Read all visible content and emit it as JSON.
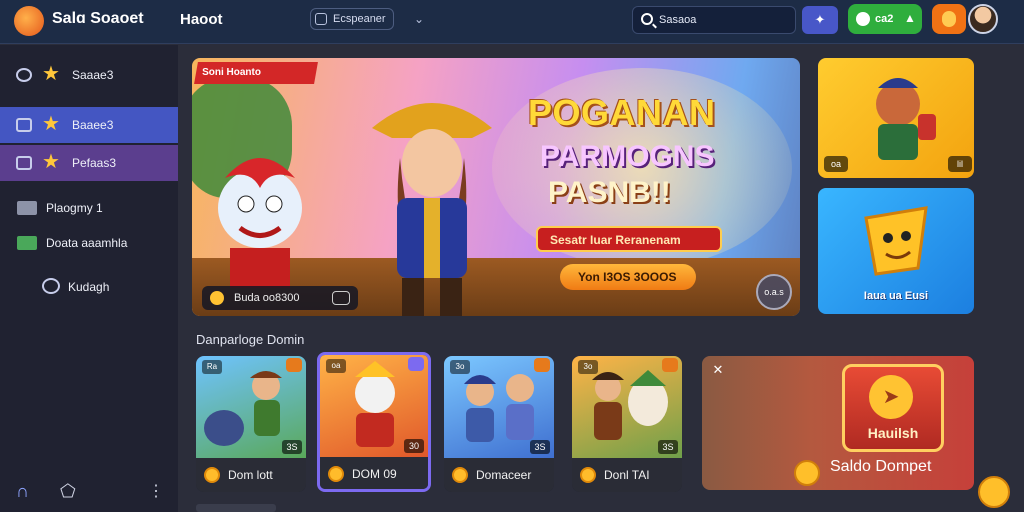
{
  "header": {
    "logo_text": "Salɑ Soaoet",
    "nav_title": "Haoot",
    "select_label": "Ecspeaner",
    "search_value": "Sasaoa",
    "green_button_label": "ca2",
    "colors": {
      "bar": "#1d2c46",
      "green": "#2fae3d",
      "orange": "#f07214",
      "blue": "#4857c8"
    }
  },
  "sidebar": {
    "items": [
      {
        "label": "Saaae3",
        "icon": "star-icon"
      },
      {
        "label": "Baaee3",
        "icon": "star-icon"
      },
      {
        "label": "Pefaas3",
        "icon": "star-icon"
      },
      {
        "label": "Plaogmy 1",
        "icon": "folder-icon"
      },
      {
        "label": "Doata aaamhla",
        "icon": "wallet-icon"
      },
      {
        "label": "Kudagh",
        "icon": "chat-icon"
      }
    ],
    "active_colors": [
      "#4456c2",
      "#5b3e8e"
    ]
  },
  "hero": {
    "badge": "Soni Hoanto",
    "title_line1": "POGANAN",
    "title_line2": "PARMOGNS",
    "title_line3": "PASNB!!",
    "ribbon": "Sesatr Iuar Reranenam",
    "cta": "Yon I3OS 3OOOS",
    "info": "Buda oo8300",
    "nav_label": "o.a.s"
  },
  "side_cards": [
    {
      "tag_left": "oa",
      "tag_right": "lil"
    },
    {
      "label": "Iaua ua Eusi"
    }
  ],
  "section": {
    "title": "Danparloge Domin",
    "games": [
      {
        "name": "Dom lott",
        "badge": "3S",
        "tl": "Ra"
      },
      {
        "name": "DOM 09",
        "badge": "30",
        "tl": "oa"
      },
      {
        "name": "Domaceer",
        "badge": "3S",
        "tl": "3o"
      },
      {
        "name": "Donl TAI",
        "badge": "3S",
        "tl": "3o"
      }
    ]
  },
  "wallet": {
    "box_label": "Hauilsh",
    "title": "Saldo Dompet"
  }
}
